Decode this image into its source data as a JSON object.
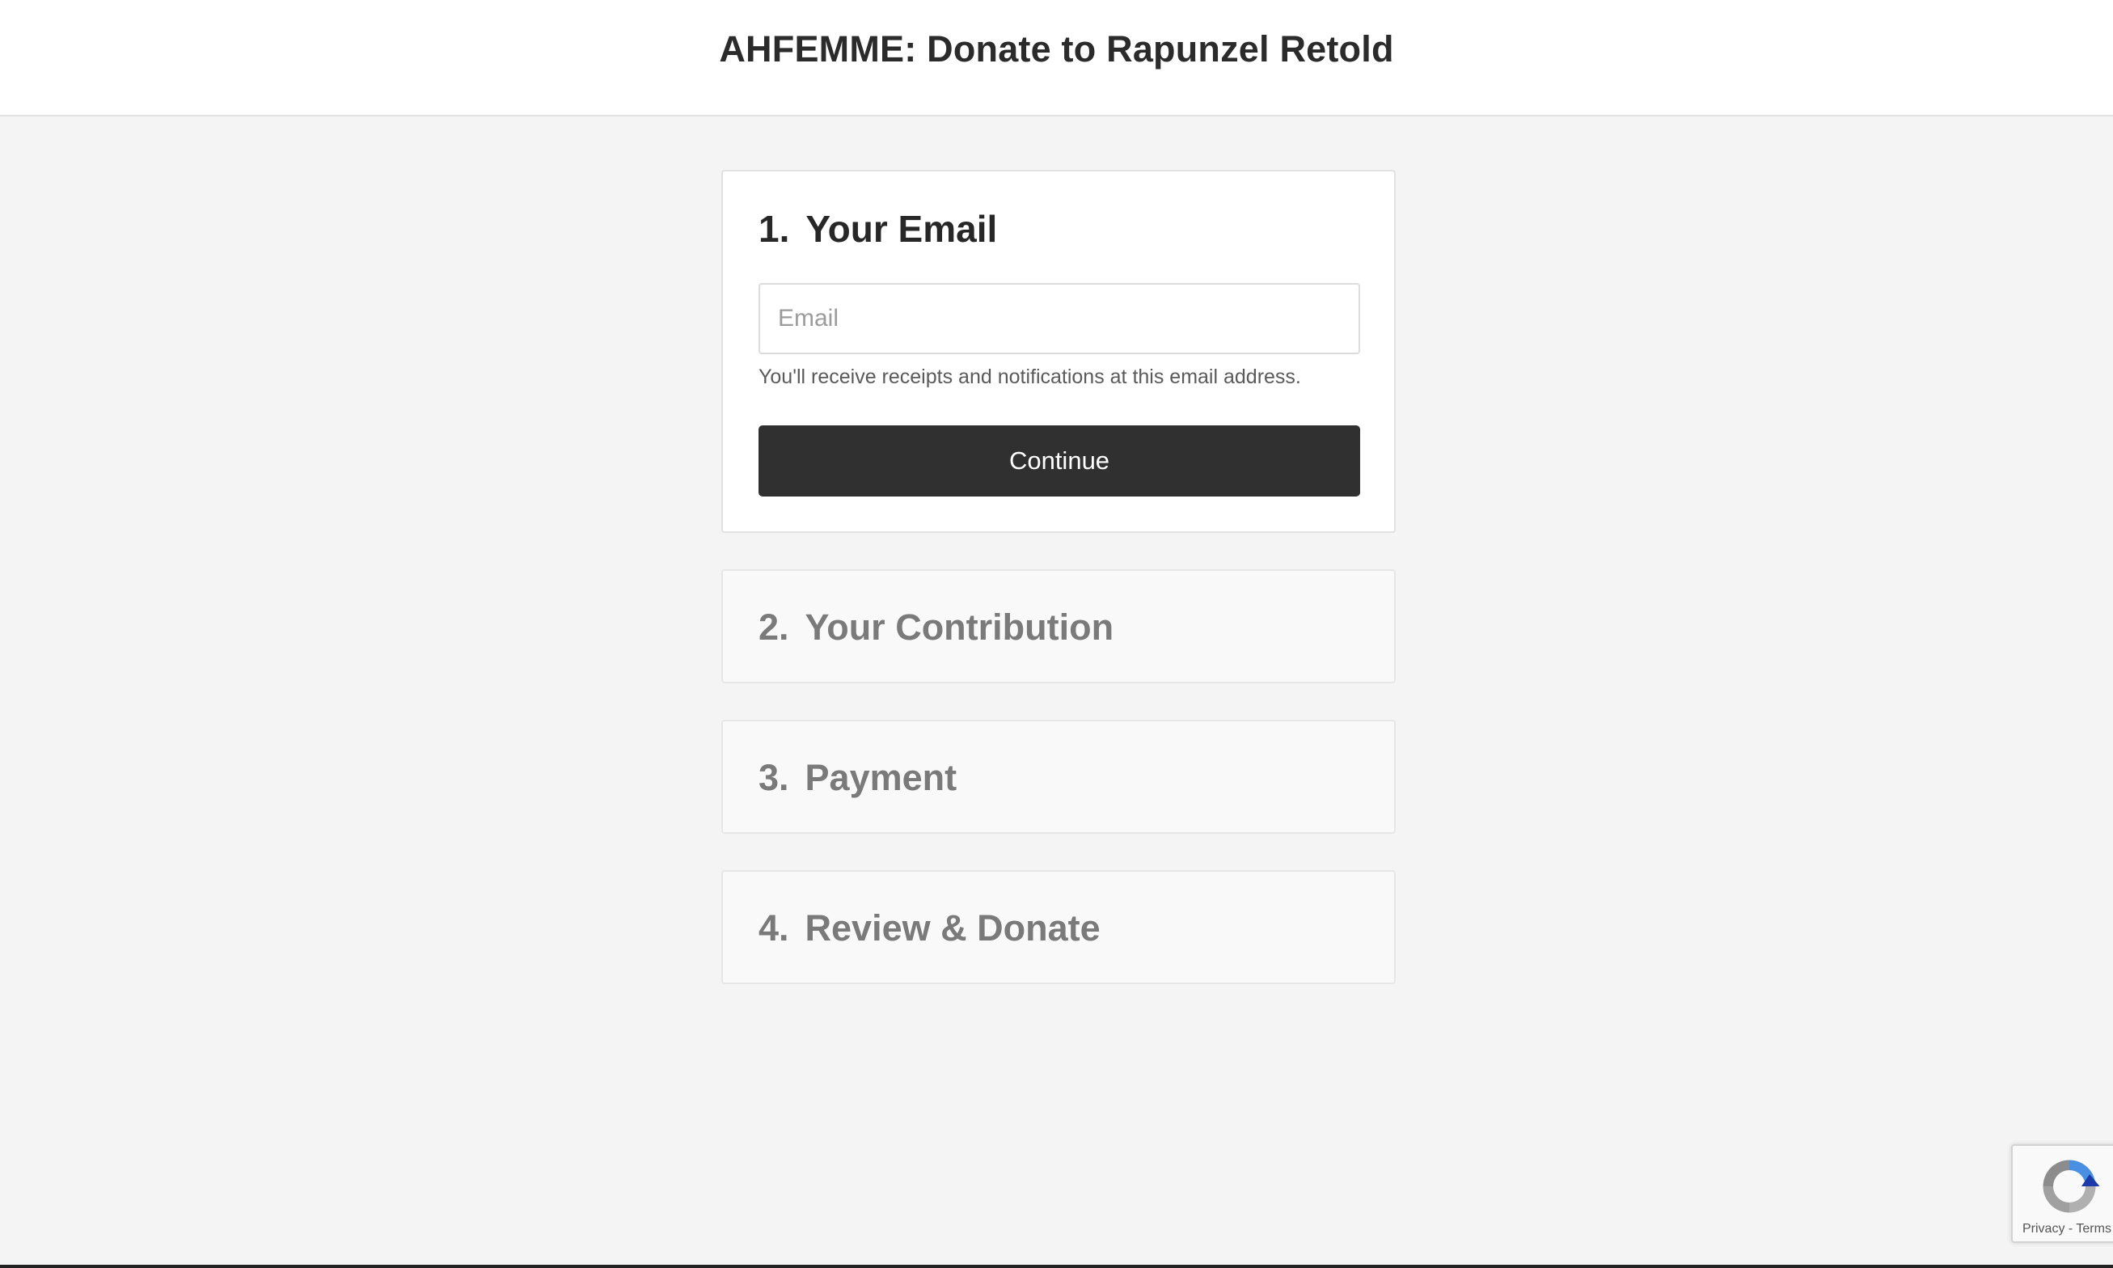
{
  "header": {
    "title": "AHFEMME: Donate to Rapunzel Retold"
  },
  "steps": [
    {
      "number": "1.",
      "title": "Your Email",
      "email_placeholder": "Email",
      "email_value": "",
      "help_text": "You'll receive receipts and notifications at this email address.",
      "continue_label": "Continue"
    },
    {
      "number": "2.",
      "title": "Your Contribution"
    },
    {
      "number": "3.",
      "title": "Payment"
    },
    {
      "number": "4.",
      "title": "Review & Donate"
    }
  ],
  "recaptcha": {
    "privacy_label": "Privacy",
    "separator": " - ",
    "terms_label": "Terms"
  },
  "colors": {
    "button_bg": "#303030",
    "page_bg": "#f4f4f4",
    "active_text": "#272727",
    "inactive_text": "#7a7a7a"
  }
}
